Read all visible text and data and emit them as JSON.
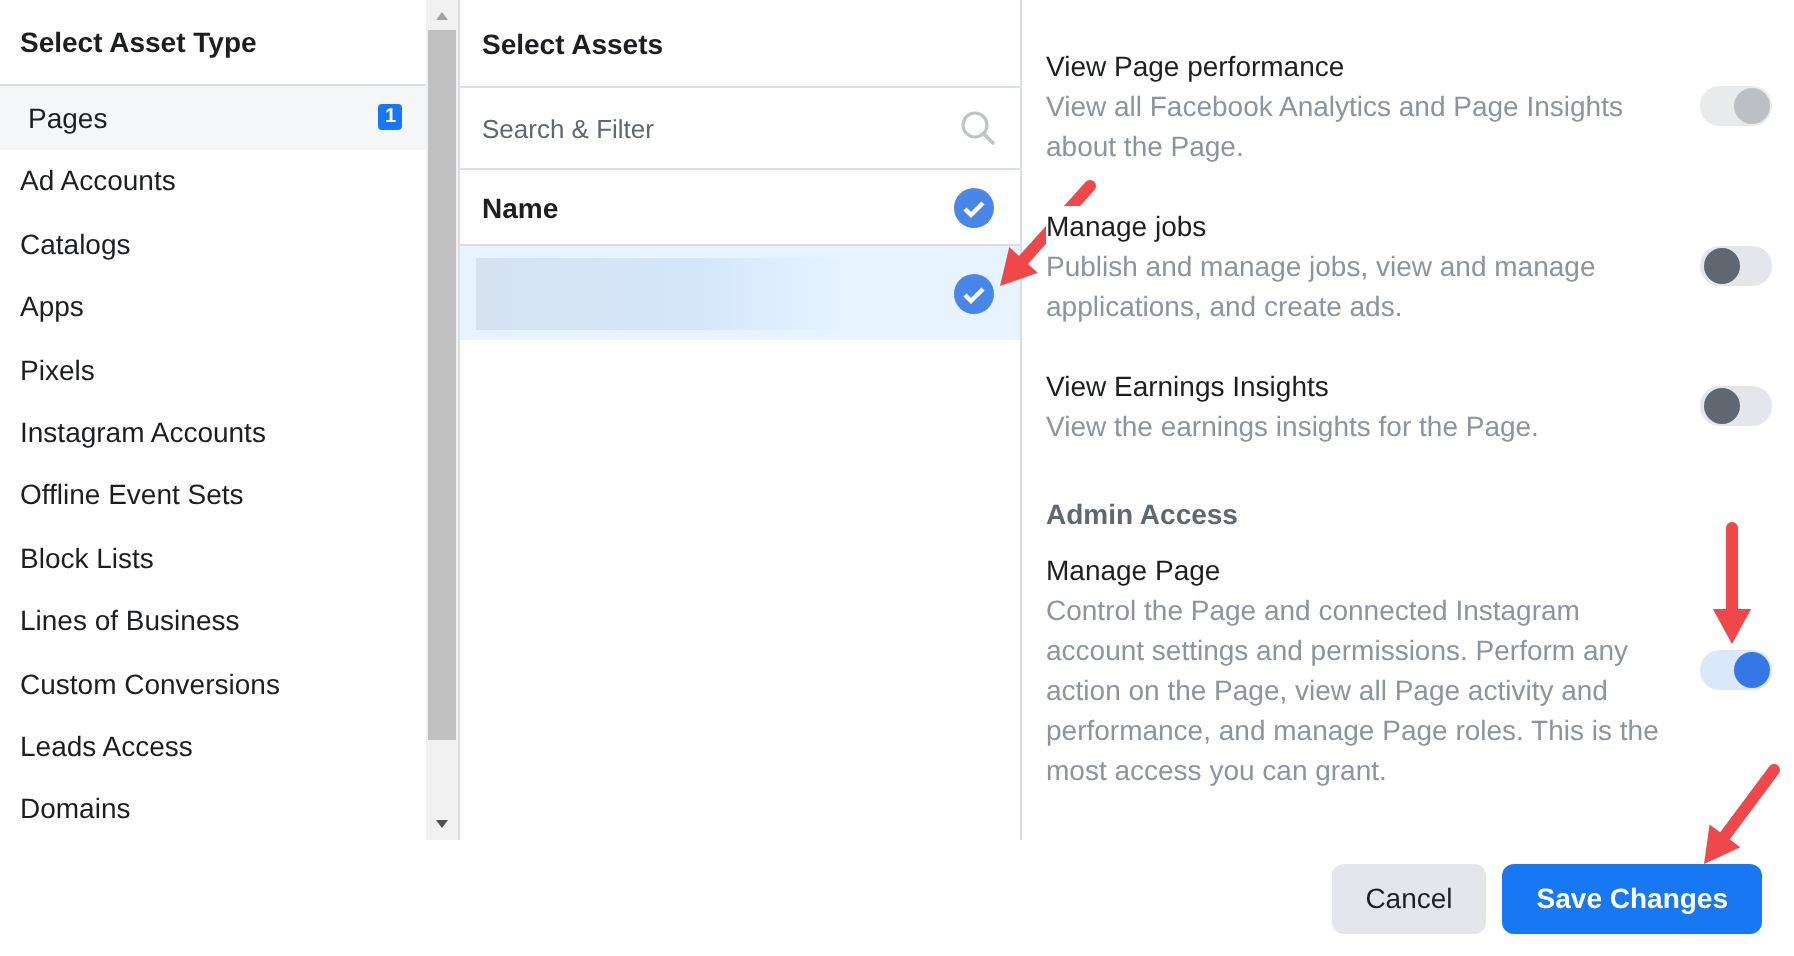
{
  "asset_types": {
    "title": "Select Asset Type",
    "items": [
      {
        "label": "Pages",
        "selected": true,
        "badge": "1"
      },
      {
        "label": "Ad Accounts",
        "selected": false
      },
      {
        "label": "Catalogs",
        "selected": false
      },
      {
        "label": "Apps",
        "selected": false
      },
      {
        "label": "Pixels",
        "selected": false
      },
      {
        "label": "Instagram Accounts",
        "selected": false
      },
      {
        "label": "Offline Event Sets",
        "selected": false
      },
      {
        "label": "Block Lists",
        "selected": false
      },
      {
        "label": "Lines of Business",
        "selected": false
      },
      {
        "label": "Custom Conversions",
        "selected": false
      },
      {
        "label": "Leads Access",
        "selected": false
      },
      {
        "label": "Domains",
        "selected": false
      }
    ]
  },
  "assets": {
    "title": "Select Assets",
    "search": {
      "placeholder": "Search & Filter"
    },
    "header": {
      "label": "Name",
      "checked": true
    },
    "rows": [
      {
        "selected": true,
        "checked": true
      }
    ]
  },
  "permissions": [
    {
      "kind": "toggle",
      "title": "View Page performance",
      "description": "View all Facebook Analytics and Page Insights about the Page.",
      "on": true,
      "disabled": true
    },
    {
      "kind": "toggle",
      "title": "Manage jobs",
      "description": "Publish and manage jobs, view and manage applications, and create ads.",
      "on": false,
      "disabled": false
    },
    {
      "kind": "toggle",
      "title": "View Earnings Insights",
      "description": "View the earnings insights for the Page.",
      "on": false,
      "disabled": false
    },
    {
      "kind": "section",
      "title": "Admin Access"
    },
    {
      "kind": "toggle",
      "title": "Manage Page",
      "description": "Control the Page and connected Instagram account settings and permissions. Perform any action on the Page, view all Page activity and performance, and manage Page roles. This is the most access you can grant.",
      "on": true,
      "disabled": false
    }
  ],
  "buttons": [
    {
      "label": "Cancel",
      "kind": "secondary"
    },
    {
      "label": "Save Changes",
      "kind": "primary"
    }
  ]
}
